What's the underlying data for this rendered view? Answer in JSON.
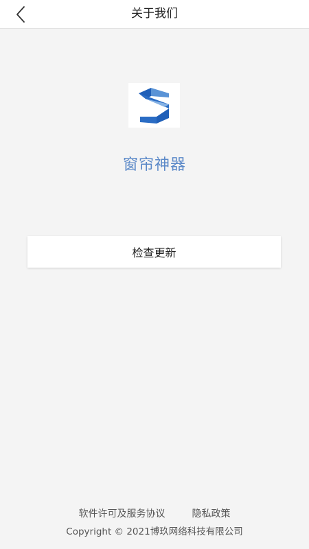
{
  "header": {
    "title": "关于我们",
    "back_icon": "chevron-left-icon"
  },
  "app": {
    "logo_icon": "app-logo-s-icon",
    "name": "窗帘神器",
    "name_color": "#5b89c8"
  },
  "actions": {
    "check_update_label": "检查更新"
  },
  "footer": {
    "license_link": "软件许可及服务协议",
    "privacy_link": "隐私政策",
    "copyright": "Copyright © 2021博玖网络科技有限公司"
  },
  "colors": {
    "background": "#f4f4f4",
    "logo_blue_dark": "#1f5fb8",
    "logo_blue_light": "#5a93d6"
  }
}
